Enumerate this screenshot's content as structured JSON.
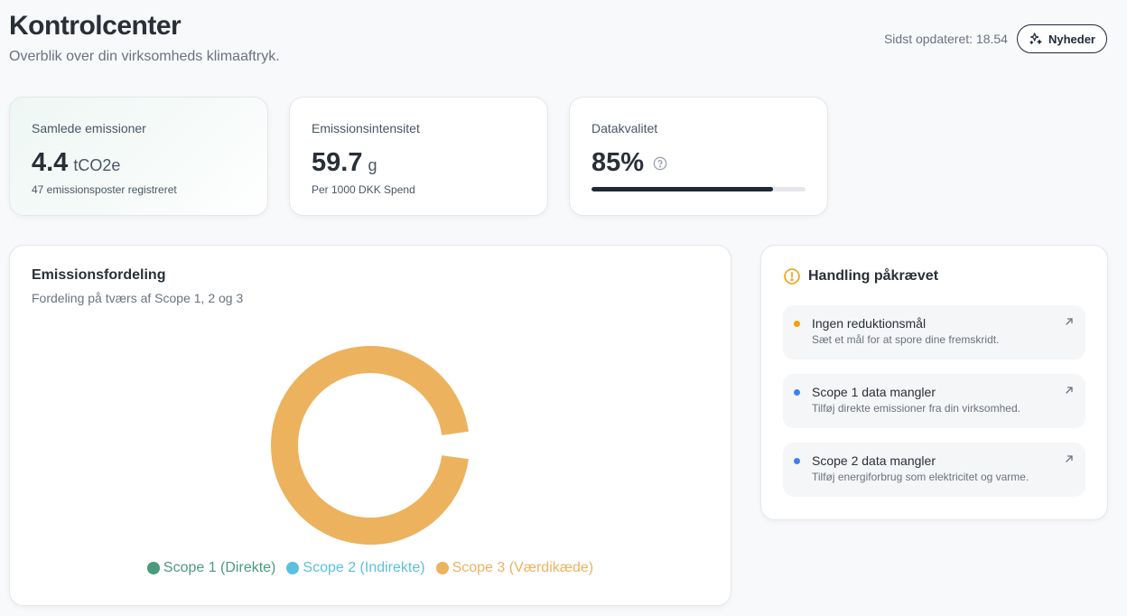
{
  "header": {
    "title": "Kontrolcenter",
    "subtitle": "Overblik over din virksomheds klimaaftryk.",
    "updated": "Sidst opdateret: 18.54",
    "news_label": "Nyheder",
    "news_icon": "sparkles-icon"
  },
  "kpis": [
    {
      "label": "Samlede emissioner",
      "value": "4.4",
      "unit": "tCO2e",
      "sub": "47 emissionsposter registreret"
    },
    {
      "label": "Emissionsintensitet",
      "value": "59.7",
      "unit": "g",
      "sub": "Per 1000 DKK Spend"
    },
    {
      "label": "Datakvalitet",
      "value": "85%",
      "progress": 0.85,
      "icon": "help-circle-icon"
    }
  ],
  "distribution": {
    "title": "Emissionsfordeling",
    "subtitle": "Fordeling på tværs af Scope 1, 2 og 3"
  },
  "chart_data": {
    "type": "pie",
    "donut": true,
    "categories": [
      "Scope 1 (Direkte)",
      "Scope 2 (Indirekte)",
      "Scope 3 (Værdikæde)"
    ],
    "values": [
      0,
      0,
      1
    ],
    "colors": [
      "#4a9a7c",
      "#5bc0de",
      "#edb25e"
    ],
    "legend": "bottom"
  },
  "actions": {
    "title": "Handling påkrævet",
    "icon": "alert-circle-icon",
    "items": [
      {
        "title": "Ingen reduktionsmål",
        "desc": "Sæt et mål for at spore dine fremskridt.",
        "color": "#f59e0b"
      },
      {
        "title": "Scope 1 data mangler",
        "desc": "Tilføj direkte emissioner fra din virksomhed.",
        "color": "#3b82f6"
      },
      {
        "title": "Scope 2 data mangler",
        "desc": "Tilføj energiforbrug som elektricitet og varme.",
        "color": "#3b82f6"
      }
    ]
  },
  "colors": {
    "accent": "#1f2937",
    "scope3": "#edb25e",
    "warning": "#f59e0b"
  }
}
